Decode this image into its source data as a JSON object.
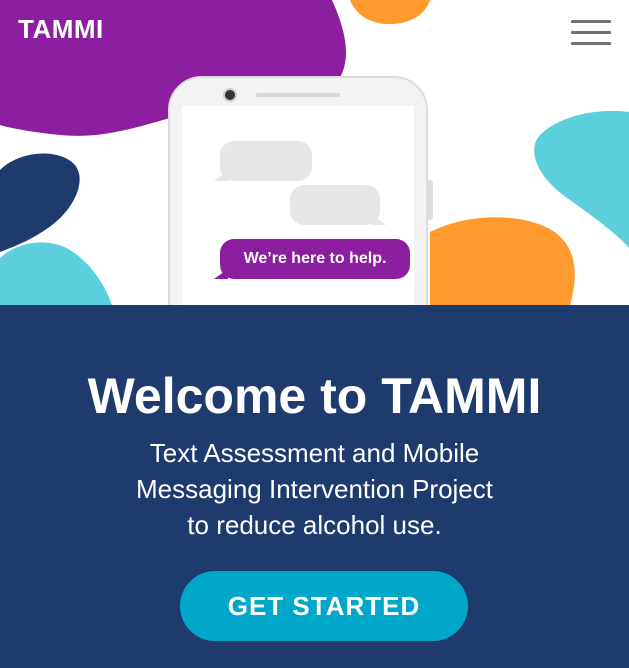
{
  "header": {
    "brand": "TAMMI",
    "menu_icon": "hamburger-menu-icon"
  },
  "hero": {
    "chat_message": "We’re here to help."
  },
  "main": {
    "title": "Welcome to TAMMI",
    "subtitle_lines": [
      "Text Assessment and Mobile",
      "Messaging Intervention Project",
      "to reduce alcohol use."
    ],
    "cta_label": "GET STARTED"
  },
  "colors": {
    "purple": "#8b1fa0",
    "navy": "#1f3b6e",
    "orange": "#ff9a2e",
    "cyan": "#5ccfdc",
    "button": "#00a7c8"
  }
}
